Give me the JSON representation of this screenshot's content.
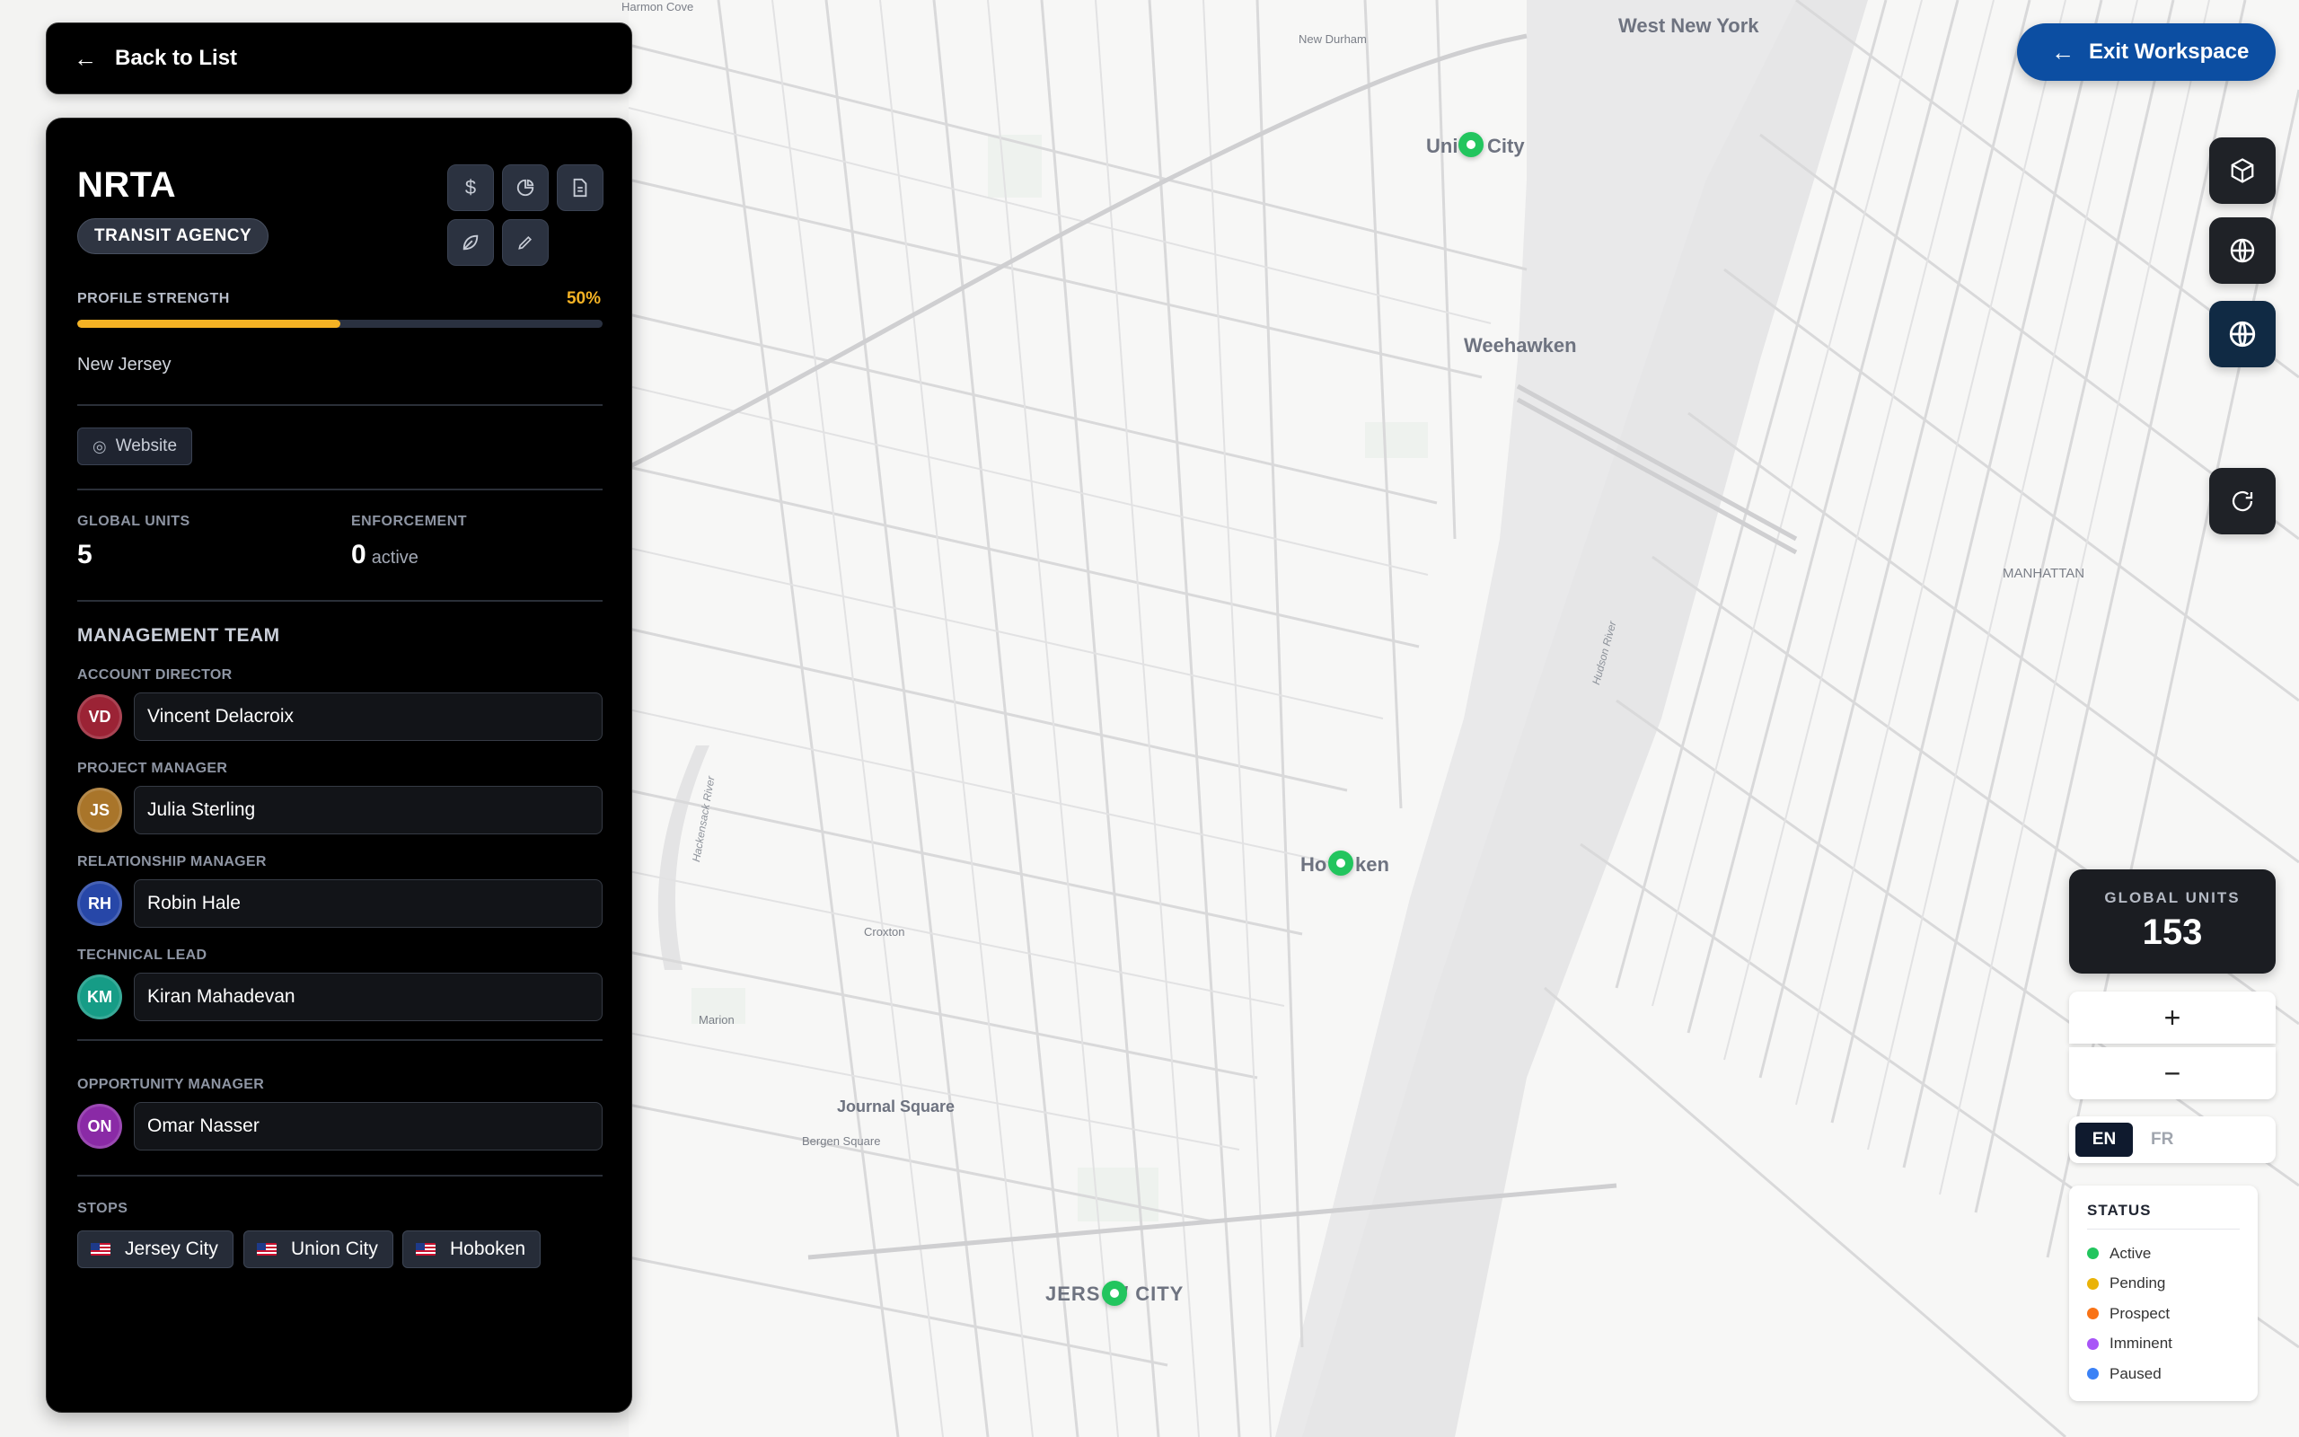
{
  "nav": {
    "back_label": "Back to List",
    "exit_label": "Exit Workspace"
  },
  "profile": {
    "name": "NRTA",
    "type_badge": "TRANSIT AGENCY",
    "strength_label": "PROFILE STRENGTH",
    "strength_value": "50%",
    "strength_fraction": 0.5,
    "region": "New Jersey",
    "website_label": "Website"
  },
  "stats": {
    "global_units_label": "GLOBAL UNITS",
    "global_units_value": "5",
    "enforcement_label": "ENFORCEMENT",
    "enforcement_value": "0",
    "enforcement_sub": "active"
  },
  "team": {
    "title": "MANAGEMENT TEAM",
    "members": [
      {
        "role": "ACCOUNT DIRECTOR",
        "initials": "VD",
        "name": "Vincent Delacroix",
        "color": "#9b2335"
      },
      {
        "role": "PROJECT MANAGER",
        "initials": "JS",
        "name": "Julia Sterling",
        "color": "#a9752a"
      },
      {
        "role": "RELATIONSHIP MANAGER",
        "initials": "RH",
        "name": "Robin Hale",
        "color": "#2747a8"
      },
      {
        "role": "TECHNICAL LEAD",
        "initials": "KM",
        "name": "Kiran Mahadevan",
        "color": "#169c86"
      },
      {
        "role": "OPPORTUNITY MANAGER",
        "initials": "ON",
        "name": "Omar Nasser",
        "color": "#8a2aa6"
      }
    ]
  },
  "stops": {
    "label": "STOPS",
    "items": [
      "Jersey City",
      "Union City",
      "Hoboken"
    ]
  },
  "map_labels": {
    "harmon_cove": "Harmon Cove",
    "new_durham": "New Durham",
    "west_new_york": "West New York",
    "union_city_a": "Uni",
    "union_city_b": "City",
    "weehawken": "Weehawken",
    "manhattan": "MANHATTAN",
    "hudson_river": "Hudson River",
    "hackensack_river": "Hackensack River",
    "hoboken_a": "Ho",
    "hoboken_b": "ken",
    "croxton": "Croxton",
    "marion": "Marion",
    "journal_square": "Journal Square",
    "bergen_square": "Bergen Square",
    "jersey_city_a": "JERS",
    "jersey_city_b": "/ CITY"
  },
  "map_panel": {
    "global_units_label": "GLOBAL UNITS",
    "global_units_value": "153",
    "zoom_in": "+",
    "zoom_out": "−",
    "lang_en": "EN",
    "lang_fr": "FR"
  },
  "legend": {
    "title": "STATUS",
    "items": [
      {
        "label": "Active",
        "color": "#22c55e"
      },
      {
        "label": "Pending",
        "color": "#eab308"
      },
      {
        "label": "Prospect",
        "color": "#f97316"
      },
      {
        "label": "Imminent",
        "color": "#a855f7"
      },
      {
        "label": "Paused",
        "color": "#3b82f6"
      }
    ]
  },
  "colors": {
    "accent_blue": "#0c4ea2",
    "strength": "#f5b324",
    "marker": "#22c55e"
  }
}
